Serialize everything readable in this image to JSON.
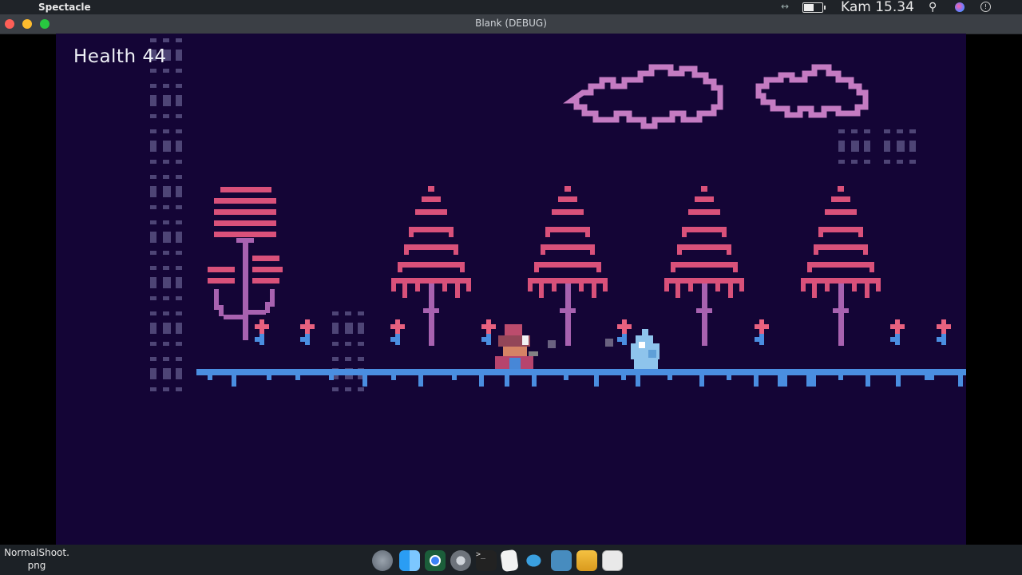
{
  "menubar": {
    "app_name": "Spectacle",
    "clock": "Kam 15.34"
  },
  "window": {
    "title": "Blank (DEBUG)"
  },
  "hud": {
    "health_label": "Health 44"
  },
  "desktop": {
    "file_label": "NormalShoot.\npng"
  },
  "dock": {
    "icons": [
      "launchpad-icon",
      "finder-icon",
      "chrome-icon",
      "system-preferences-icon",
      "terminal-icon",
      "textedit-icon",
      "fish-icon",
      "godot-icon",
      "notes-icon",
      "preview-icon",
      "apple-icon"
    ]
  },
  "colors": {
    "game_bg": "#140536",
    "tree_pink": "#d9517a",
    "trunk_purple": "#a862b0",
    "cloud": "#c47bc2",
    "ground_blue": "#4a8ee0",
    "debug_tile": "#4e4576"
  }
}
